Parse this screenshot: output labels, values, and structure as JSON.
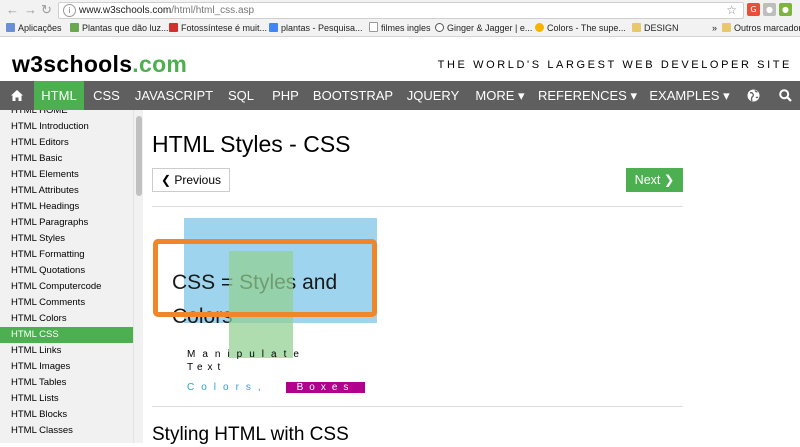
{
  "browser": {
    "back_icon": "arrow-left-icon",
    "forward_icon": "arrow-right-icon",
    "reload_icon": "reload-icon",
    "url_host": "www.w3schools.com",
    "url_path": "/html/html_css.asp",
    "star_icon": "star-icon"
  },
  "bookmarks": {
    "items": [
      {
        "label": "Aplicações"
      },
      {
        "label": "Plantas que dão luz..."
      },
      {
        "label": "Fotossíntese é muit..."
      },
      {
        "label": "plantas - Pesquisa..."
      },
      {
        "label": "filmes ingles"
      },
      {
        "label": "Ginger & Jagger | e..."
      },
      {
        "label": "Colors - The supe..."
      },
      {
        "label": "DESIGN"
      }
    ],
    "overflow": "»",
    "other": "Outros marcador"
  },
  "site": {
    "logo_main": "w3schools",
    "logo_tld": ".com",
    "tagline": "THE WORLD'S LARGEST WEB DEVELOPER SITE"
  },
  "topnav": {
    "items": [
      {
        "label": "HTML"
      },
      {
        "label": "CSS"
      },
      {
        "label": "JAVASCRIPT"
      },
      {
        "label": "SQL"
      },
      {
        "label": "PHP"
      },
      {
        "label": "BOOTSTRAP"
      },
      {
        "label": "JQUERY"
      },
      {
        "label": "MORE ▾"
      },
      {
        "label": "REFERENCES ▾"
      },
      {
        "label": "EXAMPLES ▾"
      }
    ],
    "home_icon": "home-icon",
    "globe_icon": "globe-icon",
    "search_icon": "search-icon",
    "active_color": "#4caf50"
  },
  "sidebar": {
    "items": [
      {
        "label": "HTML HOME"
      },
      {
        "label": "HTML Introduction"
      },
      {
        "label": "HTML Editors"
      },
      {
        "label": "HTML Basic"
      },
      {
        "label": "HTML Elements"
      },
      {
        "label": "HTML Attributes"
      },
      {
        "label": "HTML Headings"
      },
      {
        "label": "HTML Paragraphs"
      },
      {
        "label": "HTML Styles"
      },
      {
        "label": "HTML Formatting"
      },
      {
        "label": "HTML Quotations"
      },
      {
        "label": "HTML Computercode"
      },
      {
        "label": "HTML Comments"
      },
      {
        "label": "HTML Colors"
      },
      {
        "label": "HTML CSS"
      },
      {
        "label": "HTML Links"
      },
      {
        "label": "HTML Images"
      },
      {
        "label": "HTML Tables"
      },
      {
        "label": "HTML Lists"
      },
      {
        "label": "HTML Blocks"
      },
      {
        "label": "HTML Classes"
      }
    ],
    "active_index": 14
  },
  "main": {
    "title": "HTML Styles - CSS",
    "prev_label": "❮ Previous",
    "next_label": "Next ❯",
    "demo": {
      "headline": "CSS = Styles and Colors",
      "manipulate": "Manipulate",
      "text": "Text",
      "colors": "Colors,",
      "boxes": "Boxes"
    },
    "subheading": "Styling HTML with CSS"
  }
}
